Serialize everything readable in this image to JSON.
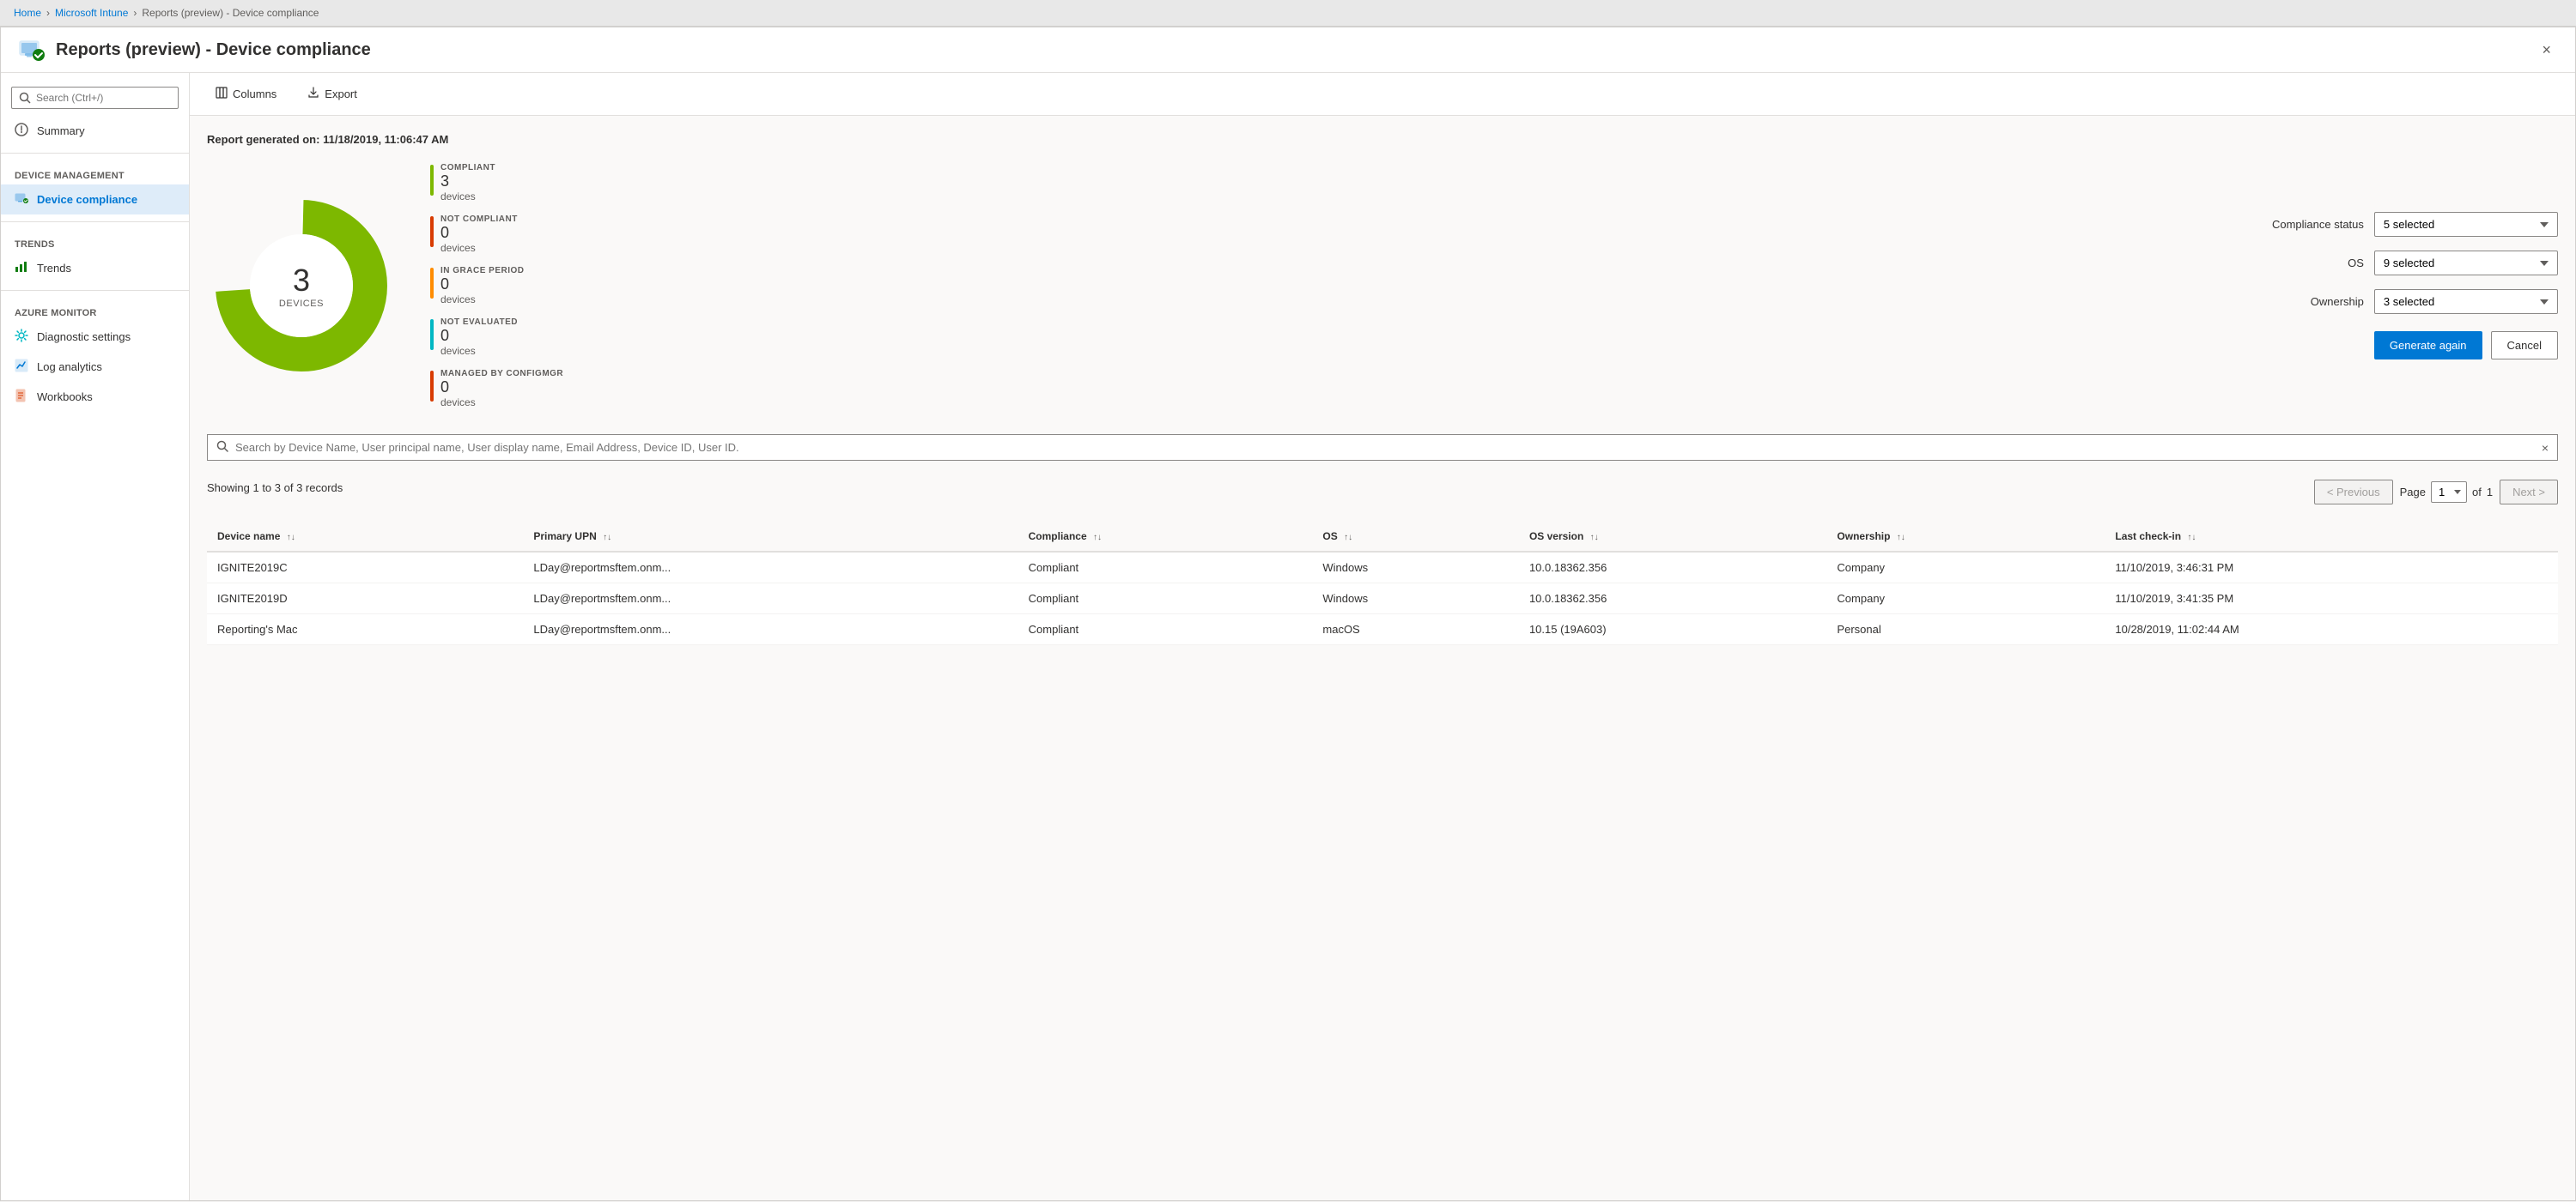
{
  "breadcrumb": {
    "items": [
      "Home",
      "Microsoft Intune",
      "Reports (preview) - Device compliance"
    ],
    "separators": [
      ">",
      ">"
    ]
  },
  "header": {
    "title": "Reports (preview) - Device compliance",
    "close_label": "×"
  },
  "sidebar": {
    "search_placeholder": "Search (Ctrl+/)",
    "collapse_icon": "«",
    "sections": [
      {
        "items": [
          {
            "id": "summary",
            "label": "Summary",
            "icon": "circle-icon",
            "active": false
          }
        ]
      },
      {
        "label": "Device management",
        "items": [
          {
            "id": "device-compliance",
            "label": "Device compliance",
            "icon": "device-icon",
            "active": true
          }
        ]
      },
      {
        "label": "Trends",
        "items": [
          {
            "id": "trends",
            "label": "Trends",
            "icon": "bar-chart-icon",
            "active": false
          }
        ]
      },
      {
        "label": "Azure monitor",
        "items": [
          {
            "id": "diagnostic-settings",
            "label": "Diagnostic settings",
            "icon": "gear-icon",
            "active": false
          },
          {
            "id": "log-analytics",
            "label": "Log analytics",
            "icon": "analytics-icon",
            "active": false
          },
          {
            "id": "workbooks",
            "label": "Workbooks",
            "icon": "book-icon",
            "active": false
          }
        ]
      }
    ]
  },
  "toolbar": {
    "columns_label": "Columns",
    "export_label": "Export"
  },
  "report": {
    "generated_label": "Report generated on:",
    "generated_date": "11/18/2019, 11:06:47 AM",
    "donut": {
      "total": "3",
      "total_label": "DEVICES"
    },
    "legend": [
      {
        "category": "COMPLIANT",
        "count": "3",
        "unit": "devices",
        "color": "#7db800"
      },
      {
        "category": "NOT COMPLIANT",
        "count": "0",
        "unit": "devices",
        "color": "#d83b01"
      },
      {
        "category": "IN GRACE PERIOD",
        "count": "0",
        "unit": "devices",
        "color": "#ff8c00"
      },
      {
        "category": "NOT EVALUATED",
        "count": "0",
        "unit": "devices",
        "color": "#00b7c3"
      },
      {
        "category": "MANAGED BY CONFIGMGR",
        "count": "0",
        "unit": "devices",
        "color": "#d83b01"
      }
    ],
    "filters": [
      {
        "label": "Compliance status",
        "value": "5 selected",
        "id": "compliance-status"
      },
      {
        "label": "OS",
        "value": "9 selected",
        "id": "os"
      },
      {
        "label": "Ownership",
        "value": "3 selected",
        "id": "ownership"
      }
    ],
    "generate_again_label": "Generate again",
    "cancel_label": "Cancel"
  },
  "search": {
    "placeholder": "Search by Device Name, User principal name, User display name, Email Address, Device ID, User ID."
  },
  "records": {
    "showing_text": "Showing 1 to 3 of 3 records"
  },
  "table": {
    "columns": [
      {
        "id": "device-name",
        "label": "Device name"
      },
      {
        "id": "primary-upn",
        "label": "Primary UPN"
      },
      {
        "id": "compliance",
        "label": "Compliance"
      },
      {
        "id": "os",
        "label": "OS"
      },
      {
        "id": "os-version",
        "label": "OS version"
      },
      {
        "id": "ownership",
        "label": "Ownership"
      },
      {
        "id": "last-checkin",
        "label": "Last check-in"
      }
    ],
    "rows": [
      {
        "device_name": "IGNITE2019C",
        "primary_upn": "LDay@reportmsftem.onm...",
        "compliance": "Compliant",
        "os": "Windows",
        "os_version": "10.0.18362.356",
        "ownership": "Company",
        "last_checkin": "11/10/2019, 3:46:31 PM"
      },
      {
        "device_name": "IGNITE2019D",
        "primary_upn": "LDay@reportmsftem.onm...",
        "compliance": "Compliant",
        "os": "Windows",
        "os_version": "10.0.18362.356",
        "ownership": "Company",
        "last_checkin": "11/10/2019, 3:41:35 PM"
      },
      {
        "device_name": "Reporting's Mac",
        "primary_upn": "LDay@reportmsftem.onm...",
        "compliance": "Compliant",
        "os": "macOS",
        "os_version": "10.15 (19A603)",
        "ownership": "Personal",
        "last_checkin": "10/28/2019, 11:02:44 AM"
      }
    ]
  },
  "pagination": {
    "previous_label": "< Previous",
    "next_label": "Next >",
    "page_label": "Page",
    "current_page": "1",
    "total_pages": "1",
    "of_label": "of"
  }
}
